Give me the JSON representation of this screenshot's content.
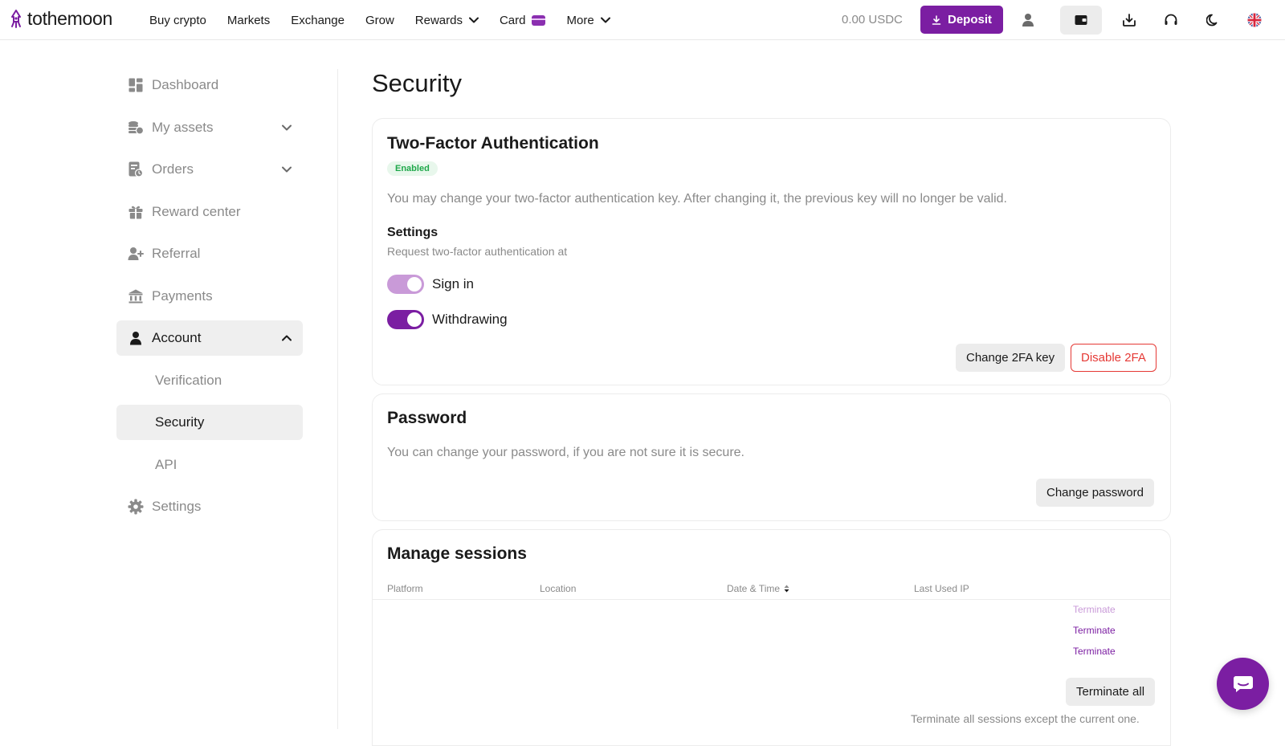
{
  "header": {
    "logo_text": "tothemoon",
    "nav": [
      {
        "label": "Buy crypto"
      },
      {
        "label": "Markets"
      },
      {
        "label": "Exchange"
      },
      {
        "label": "Grow"
      },
      {
        "label": "Rewards"
      },
      {
        "label": "Card"
      },
      {
        "label": "More"
      }
    ],
    "balance": "0.00 USDC",
    "deposit_label": "Deposit",
    "icons": [
      "user-icon",
      "wallet-icon",
      "download-icon",
      "headset-icon",
      "moon-icon",
      "uk-flag-icon"
    ]
  },
  "sidebar": {
    "items": [
      {
        "label": "Dashboard",
        "icon": "dashboard-icon"
      },
      {
        "label": "My assets",
        "icon": "coins-icon"
      },
      {
        "label": "Orders",
        "icon": "orders-icon"
      },
      {
        "label": "Reward center",
        "icon": "gift-icon"
      },
      {
        "label": "Referral",
        "icon": "add-user-icon"
      },
      {
        "label": "Payments",
        "icon": "bank-icon"
      },
      {
        "label": "Account",
        "icon": "person-icon"
      },
      {
        "label": "Settings",
        "icon": "gear-icon"
      }
    ],
    "account_sub": [
      {
        "label": "Verification"
      },
      {
        "label": "Security"
      },
      {
        "label": "API"
      }
    ]
  },
  "main": {
    "title": "Security",
    "twofa": {
      "title": "Two-Factor Authentication",
      "badge": "Enabled",
      "description": "You may change your two-factor authentication key. After changing it, the previous key will no longer be valid.",
      "settings_title": "Settings",
      "settings_sub": "Request two-factor authentication at",
      "toggles": [
        {
          "label": "Sign in",
          "color": "#c99ad8"
        },
        {
          "label": "Withdrawing",
          "color": "#7b1ea2"
        }
      ],
      "change_key_label": "Change 2FA key",
      "disable_label": "Disable 2FA"
    },
    "password": {
      "title": "Password",
      "description": "You can change your password, if you are not sure it is secure.",
      "change_label": "Change password"
    },
    "sessions": {
      "title": "Manage sessions",
      "columns": [
        "Platform",
        "Location",
        "Date & Time",
        "Last Used IP"
      ],
      "rows": [
        {
          "action": "Terminate",
          "color": "#c99ad8"
        },
        {
          "action": "Terminate",
          "color": "#7b1ea2"
        },
        {
          "action": "Terminate",
          "color": "#7b1ea2"
        }
      ],
      "terminate_all_label": "Terminate all",
      "terminate_all_note": "Terminate all sessions except the current one."
    }
  },
  "colors": {
    "brand": "#7b1ea2",
    "danger": "#e53935",
    "success": "#1fa84a"
  }
}
